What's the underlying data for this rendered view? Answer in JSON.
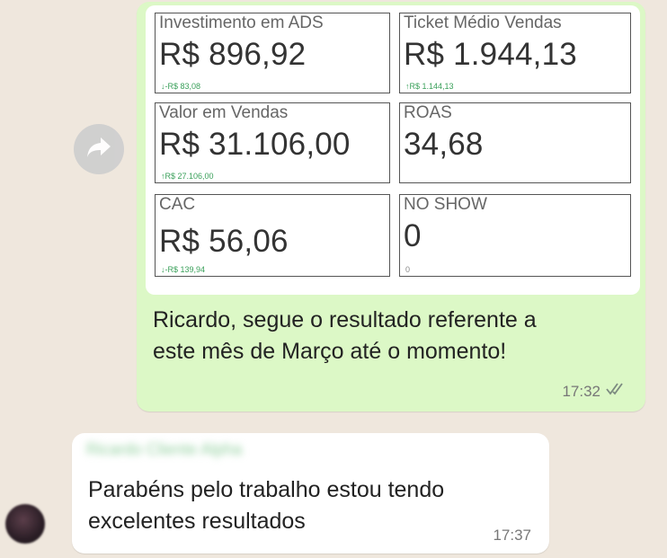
{
  "chat": {
    "outgoing": {
      "dashboard": {
        "tiles": [
          {
            "label": "Investimento em ADS",
            "value": "R$ 896,92",
            "delta": "↓-R$ 83,08"
          },
          {
            "label": "Ticket Médio Vendas",
            "value": "R$ 1.944,13",
            "delta": "↑R$ 1.144,13"
          },
          {
            "label": "Valor em Vendas",
            "value": "R$ 31.106,00",
            "delta": "↑R$ 27.106,00"
          },
          {
            "label": "ROAS",
            "value": "34,68",
            "delta": ""
          },
          {
            "label": "CAC",
            "value": "R$ 56,06",
            "delta": "↓-R$ 139,94"
          },
          {
            "label": "NO SHOW",
            "value": "0",
            "delta": "0"
          }
        ]
      },
      "text_line1": "Ricardo, segue o resultado referente a",
      "text_line2": "este mês de Março até o momento!",
      "time": "17:32"
    },
    "incoming": {
      "sender": "Ricardo Cliente Alpha",
      "text_line1": "Parabéns pelo trabalho estou tendo",
      "text_line2": "excelentes resultados",
      "time": "17:37"
    }
  },
  "icons": {
    "forward": "forward-arrow-icon",
    "read_receipt": "double-check-icon",
    "avatar": "avatar"
  },
  "colors": {
    "outgoing_bubble": "#dcf8c6",
    "incoming_bubble": "#ffffff",
    "background": "#efe7dd",
    "delta_green": "#3aa05a"
  }
}
